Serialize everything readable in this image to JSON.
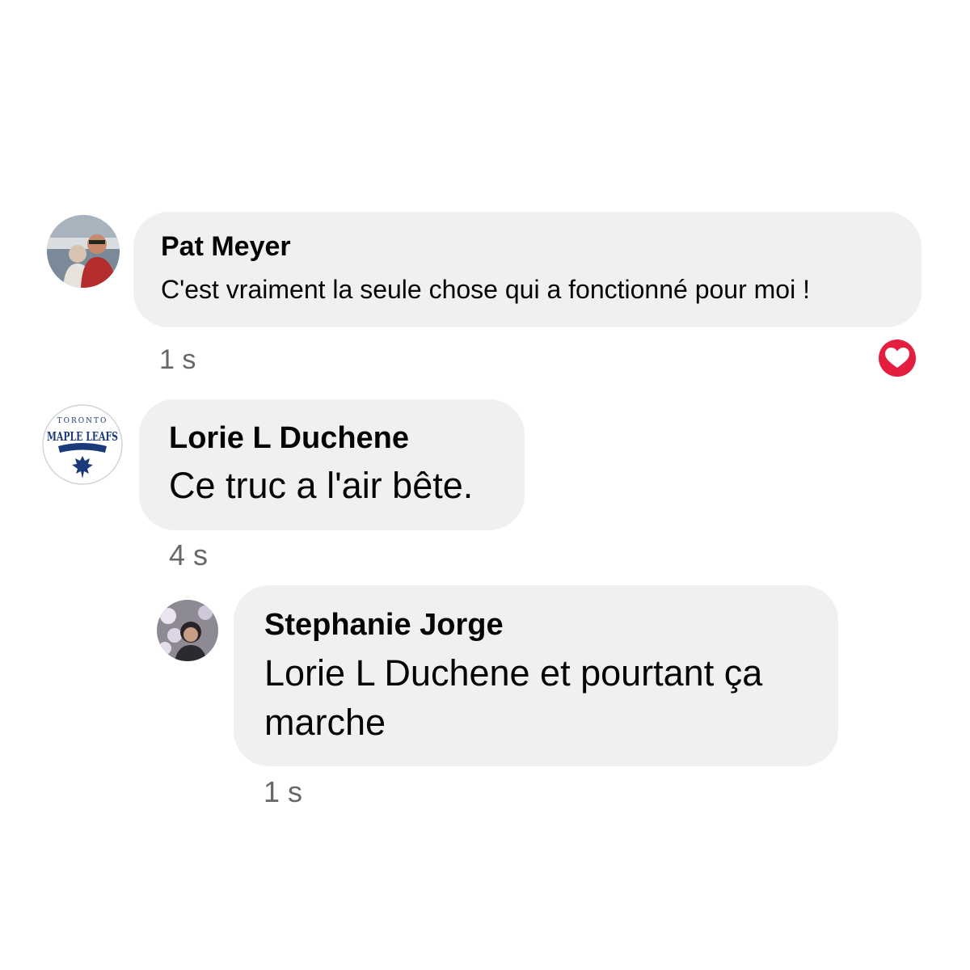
{
  "comments": [
    {
      "author": "Pat Meyer",
      "text": "C'est vraiment la seule chose qui a fonctionné pour moi !",
      "timestamp": "1 s",
      "avatar": "avatar-photo-couple",
      "reaction": "heart-icon"
    },
    {
      "author": "Lorie L Duchene",
      "text": "Ce truc a l'air bête.",
      "timestamp": "4 s",
      "avatar": "avatar-maple-leafs-logo"
    },
    {
      "author": "Stephanie Jorge",
      "text": "Lorie L Duchene et pourtant ça marche",
      "timestamp": "1 s",
      "avatar": "avatar-photo-person",
      "is_reply": true
    }
  ],
  "logo": {
    "top_text": "TORONTO",
    "main_text": "MAPLE LEAFS"
  },
  "colors": {
    "bubble": "#f0f0f3",
    "timestamp": "#65676b",
    "heart": "#e41e3f",
    "logo_blue": "#1b3a7a"
  }
}
